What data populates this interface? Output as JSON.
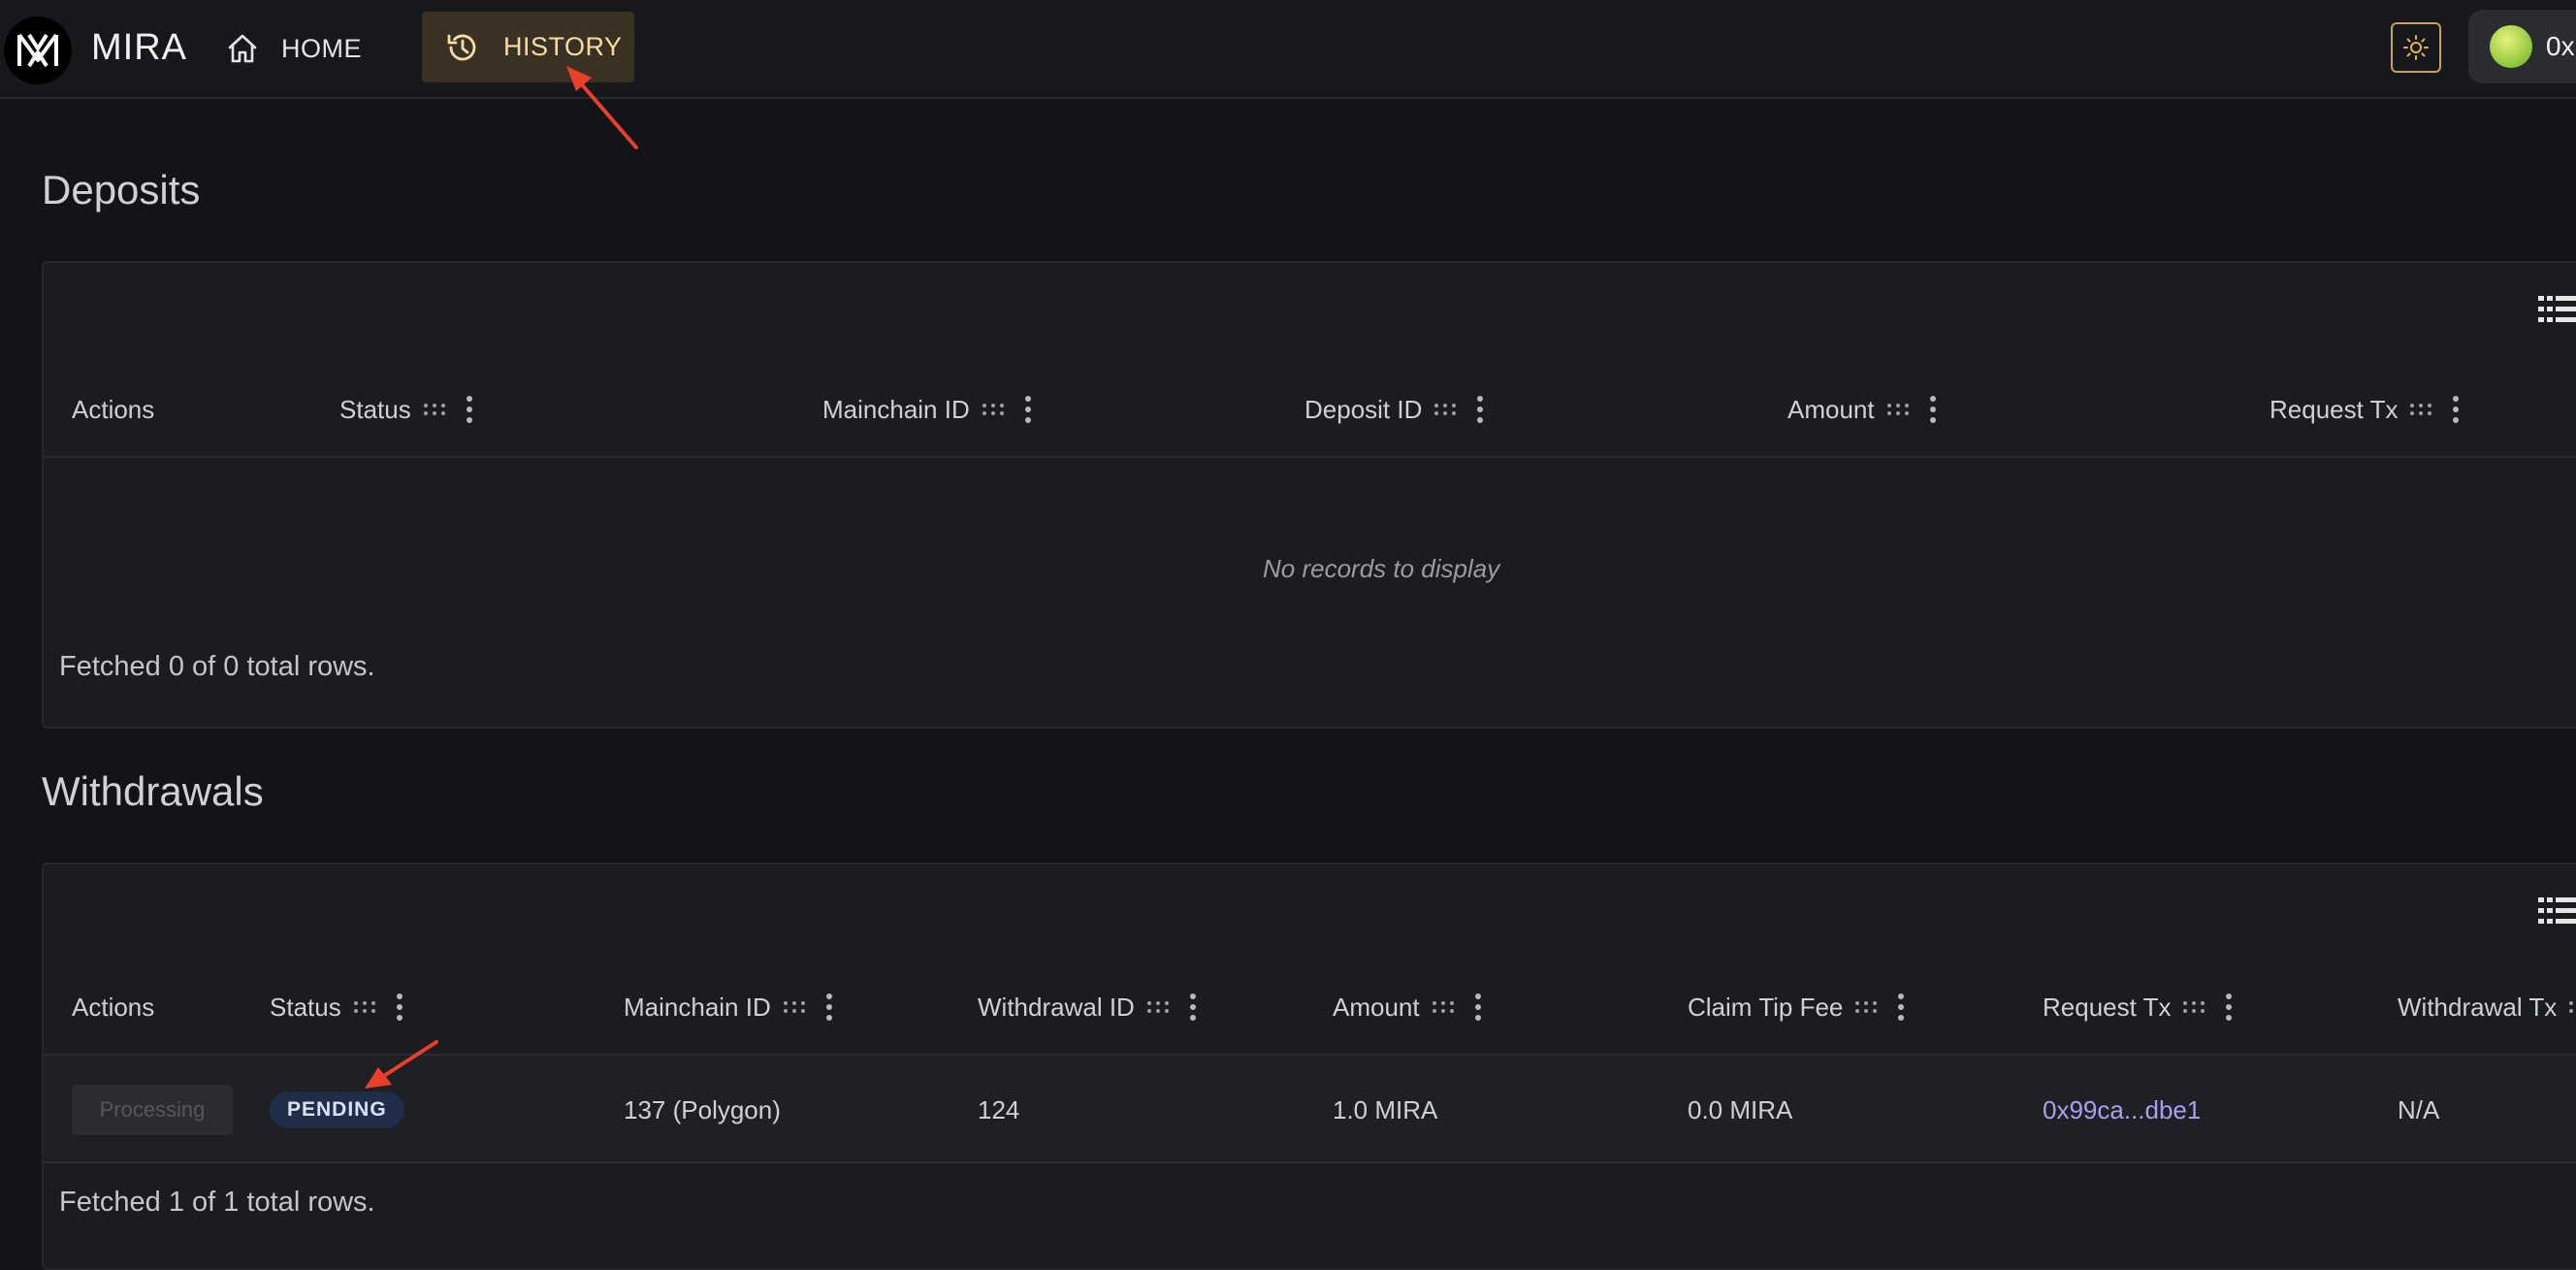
{
  "header": {
    "logo_text": "MIRA",
    "nav": [
      {
        "label": "HOME",
        "icon": "home-icon"
      },
      {
        "label": "HISTORY",
        "icon": "history-icon",
        "active": true
      }
    ],
    "theme_icon": "sun-icon",
    "wallet_text": "0x"
  },
  "deposits": {
    "title": "Deposits",
    "columns": [
      "Actions",
      "Status",
      "Mainchain ID",
      "Deposit ID",
      "Amount",
      "Request Tx"
    ],
    "empty_message": "No records to display",
    "footer": "Fetched 0 of 0 total rows."
  },
  "withdrawals": {
    "title": "Withdrawals",
    "columns": [
      "Actions",
      "Status",
      "Mainchain ID",
      "Withdrawal ID",
      "Amount",
      "Claim Tip Fee",
      "Request Tx",
      "Withdrawal Tx"
    ],
    "rows": [
      {
        "action": "Processing",
        "status": "PENDING",
        "mainchain_id": "137 (Polygon)",
        "withdrawal_id": "124",
        "amount": "1.0 MIRA",
        "claim_tip_fee": "0.0 MIRA",
        "request_tx": "0x99ca...dbe1",
        "withdrawal_tx": "N/A"
      }
    ],
    "footer": "Fetched 1 of 1 total rows."
  },
  "colors": {
    "background": "#131417",
    "panel": "#1b1c20",
    "history_active_bg": "#3a3122",
    "history_active_text": "#f6dca6",
    "pending_badge_bg": "#1f2d48",
    "link": "#a99ff0",
    "annotation_arrow": "#e8402a"
  }
}
